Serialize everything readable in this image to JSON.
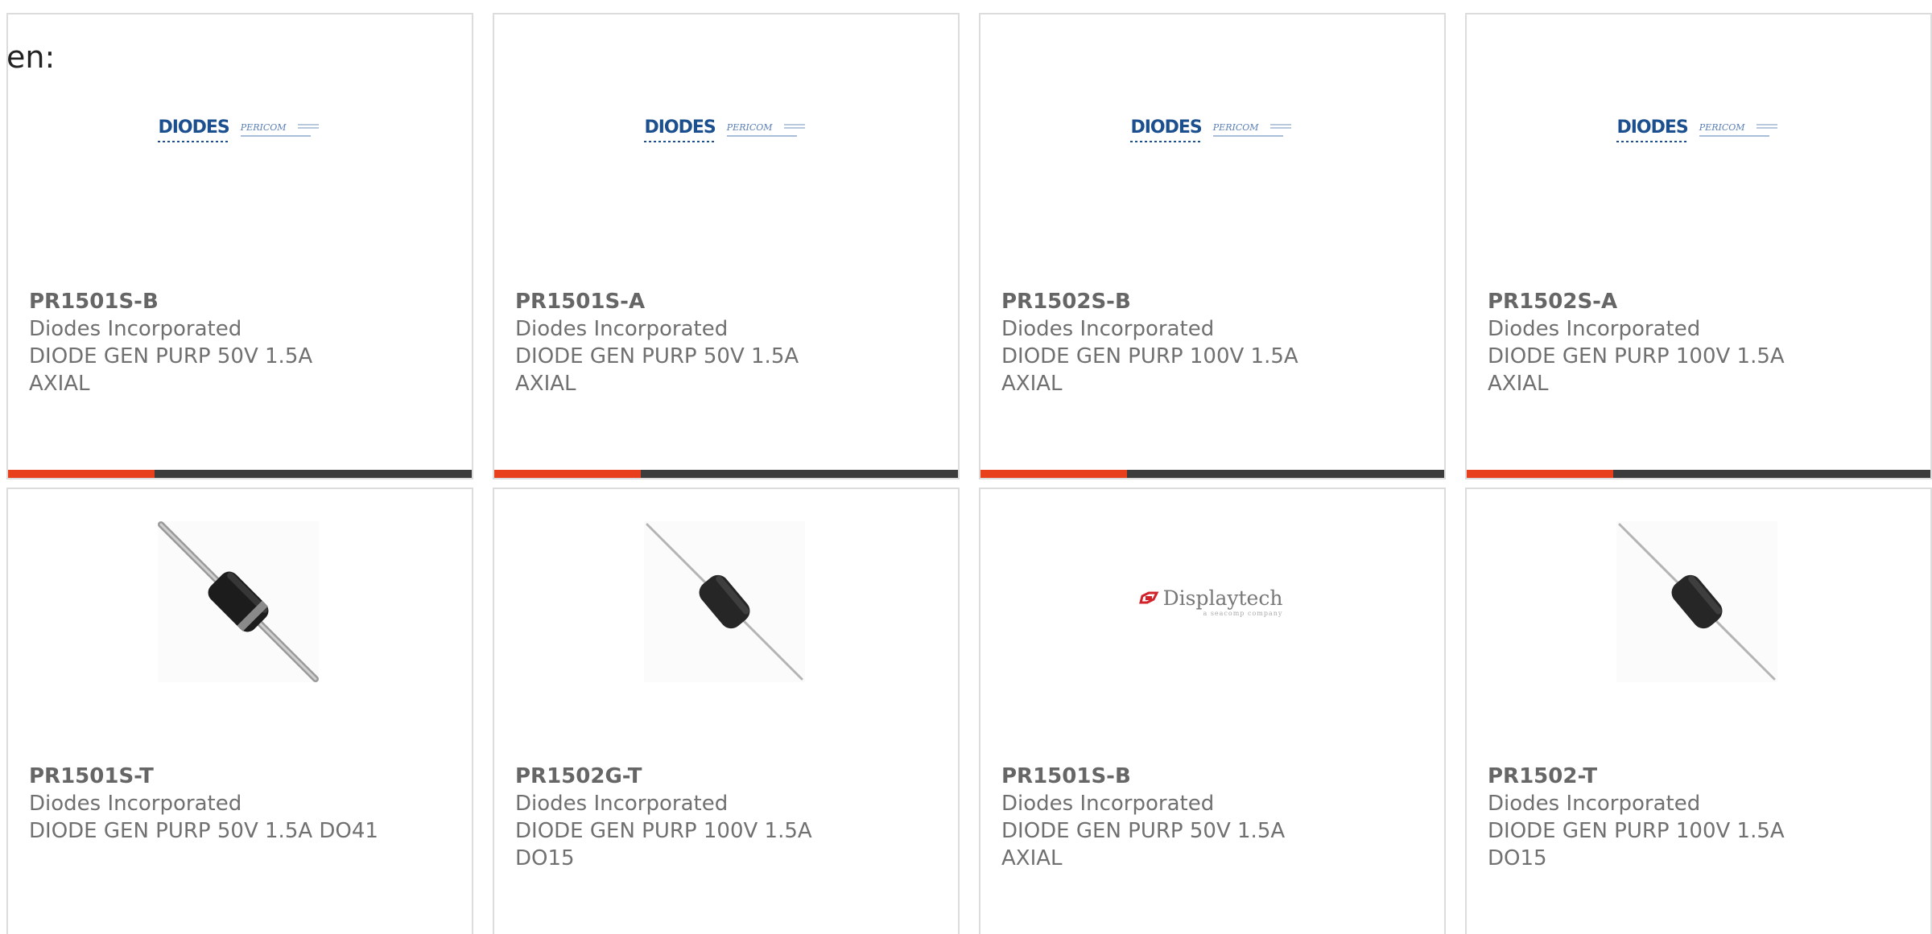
{
  "heading_fragment": "en:",
  "logos": {
    "diodes_word": "DIODES",
    "pericom_word": "PERICOM",
    "displaytech_word": "Displaytech",
    "displaytech_tag": "a seacomp company"
  },
  "colors": {
    "accent": "#e8401c",
    "bar": "#3c3c3c",
    "diodes_blue": "#1b4f8e",
    "displaytech_red": "#d2232a"
  },
  "products": [
    {
      "part_number": "PR1501S-B",
      "manufacturer": "Diodes Incorporated",
      "description_lines": [
        "DIODE GEN PURP 50V 1.5A",
        "AXIAL"
      ],
      "image": "diodes-pericom-logo",
      "bottom_bar": true
    },
    {
      "part_number": "PR1501S-A",
      "manufacturer": "Diodes Incorporated",
      "description_lines": [
        "DIODE GEN PURP 50V 1.5A",
        "AXIAL"
      ],
      "image": "diodes-pericom-logo",
      "bottom_bar": true
    },
    {
      "part_number": "PR1502S-B",
      "manufacturer": "Diodes Incorporated",
      "description_lines": [
        "DIODE GEN PURP 100V 1.5A",
        "AXIAL"
      ],
      "image": "diodes-pericom-logo",
      "bottom_bar": true
    },
    {
      "part_number": "PR1502S-A",
      "manufacturer": "Diodes Incorporated",
      "description_lines": [
        "DIODE GEN PURP 100V 1.5A",
        "AXIAL"
      ],
      "image": "diodes-pericom-logo",
      "bottom_bar": true
    },
    {
      "part_number": "PR1501S-T",
      "manufacturer": "Diodes Incorporated",
      "description_lines": [
        "DIODE GEN PURP 50V 1.5A DO41",
        ""
      ],
      "image": "axial-diode-photo-do41",
      "bottom_bar": false
    },
    {
      "part_number": "PR1502G-T",
      "manufacturer": "Diodes Incorporated",
      "description_lines": [
        "DIODE GEN PURP 100V 1.5A",
        "DO15"
      ],
      "image": "axial-diode-photo-do15",
      "bottom_bar": false
    },
    {
      "part_number": "PR1501S-B",
      "manufacturer": "Diodes Incorporated",
      "description_lines": [
        "DIODE GEN PURP 50V 1.5A",
        "AXIAL"
      ],
      "image": "displaytech-logo",
      "bottom_bar": false
    },
    {
      "part_number": "PR1502-T",
      "manufacturer": "Diodes Incorporated",
      "description_lines": [
        "DIODE GEN PURP 100V 1.5A",
        "DO15"
      ],
      "image": "axial-diode-photo-do15",
      "bottom_bar": false
    }
  ]
}
